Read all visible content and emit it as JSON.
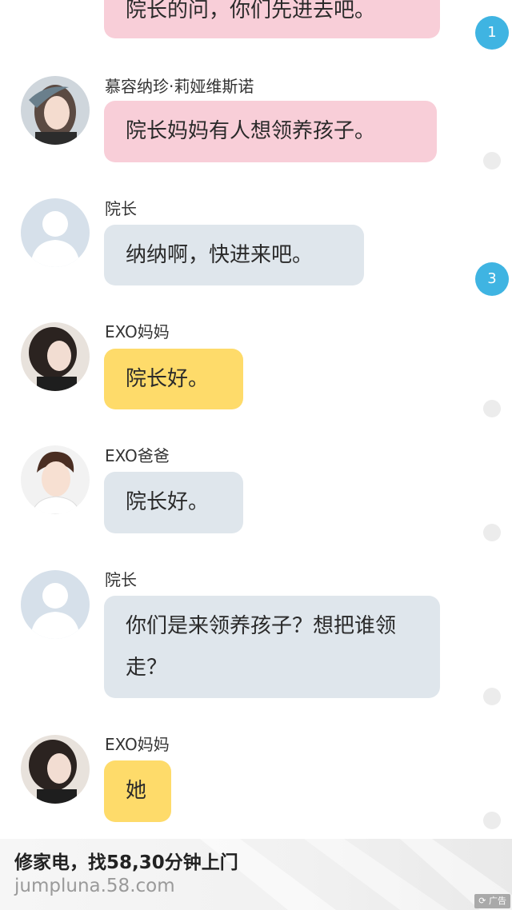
{
  "messages": [
    {
      "sender": "",
      "text": "院长的问，你们先进去吧。"
    },
    {
      "sender": "慕容纳珍·莉娅维斯诺",
      "text": "院长妈妈有人想领养孩子。"
    },
    {
      "sender": "院长",
      "text": "纳纳啊，快进来吧。"
    },
    {
      "sender": "EXO妈妈",
      "text": "院长好。"
    },
    {
      "sender": "EXO爸爸",
      "text": "院长好。"
    },
    {
      "sender": "院长",
      "text": "你们是来领养孩子？想把谁领走？"
    },
    {
      "sender": "EXO妈妈",
      "text": "她"
    }
  ],
  "badges": [
    "1",
    "3"
  ],
  "ad": {
    "title": "修家电，找58,30分钟上门",
    "url": "jumpluna.58.com",
    "tag": "广告"
  },
  "colors": {
    "pink_bubble": "#f8ced8",
    "blue_bubble": "#dfe6ec",
    "yellow_bubble": "#fedb6a",
    "badge": "#3fb4e2"
  }
}
